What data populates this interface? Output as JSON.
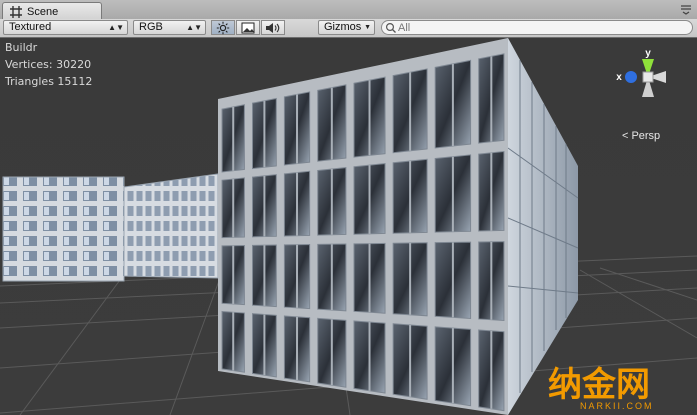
{
  "tab": {
    "title": "Scene",
    "icon": "grid-icon"
  },
  "toolbar": {
    "draw_mode": "Textured",
    "render_mode": "RGB",
    "scene_lighting_icon": "sun-icon",
    "image_toggle_icon": "image-icon",
    "audio_toggle_icon": "speaker-icon",
    "gizmos_label": "Gizmos",
    "search_placeholder": "All"
  },
  "overlay": {
    "title": "Buildr",
    "vertices": "Vertices: 30220",
    "triangles": "Triangles 15112"
  },
  "gizmo": {
    "y_label": "y",
    "x_label": "x",
    "projection": "Persp"
  },
  "colors": {
    "viewport_bg": "#3a3a3a",
    "gizmo_y": "#8fe03a",
    "gizmo_x": "#2f6fe0",
    "watermark": "#f29a00"
  },
  "watermark": {
    "text": "纳金网",
    "sub": "NARKII.COM"
  }
}
